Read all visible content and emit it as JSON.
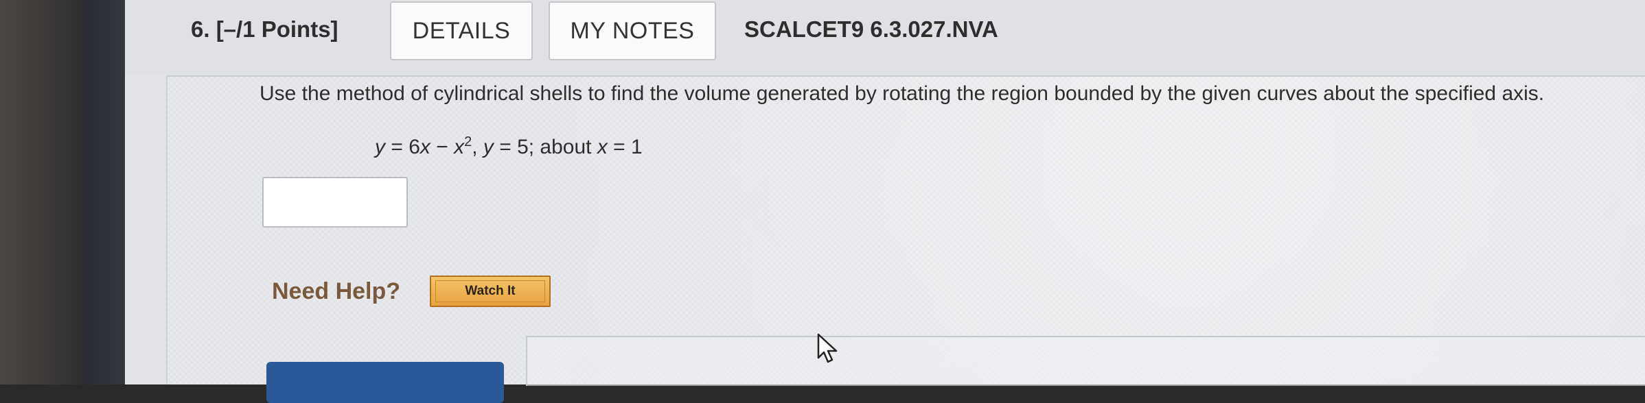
{
  "question": {
    "number_label": "6.  [–/1 Points]",
    "details_label": "DETAILS",
    "my_notes_label": "MY NOTES",
    "question_id": "SCALCET9 6.3.027.NVA",
    "prompt": "Use the method of cylindrical shells to find the volume generated by rotating the region bounded by the given curves about the specified axis.",
    "equation": {
      "y1": "y",
      "eq1": " = 6",
      "x1": "x",
      "minus": " − ",
      "x2": "x",
      "exp": "2",
      "sep1": ",    ",
      "y2": "y",
      "eq2": " = 5;    about ",
      "x3": "x",
      "eq3": " = 1"
    },
    "answer_value": ""
  },
  "help": {
    "need_help_label": "Need Help?",
    "watch_it_label": "Watch It"
  },
  "colors": {
    "need_help_text": "#7a5a3c",
    "watch_it_bg": "#f0b04e",
    "submit_button": "#2a5a9a"
  },
  "icons": {
    "cursor": "arrow-cursor-icon"
  }
}
